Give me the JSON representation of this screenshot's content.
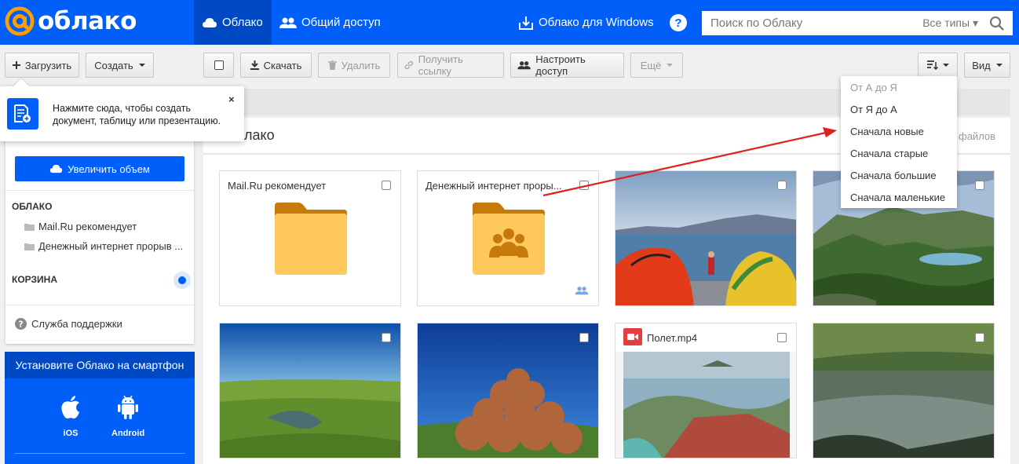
{
  "header": {
    "logo_text": "облако",
    "tabs": [
      {
        "label": "Облако"
      },
      {
        "label": "Общий доступ"
      }
    ],
    "windows_link": "Облако для Windows",
    "help": "?",
    "search": {
      "placeholder": "Поиск по Облаку",
      "types_label": "Все типы"
    }
  },
  "toolbar": {
    "upload": "Загрузить",
    "create": "Создать",
    "download": "Скачать",
    "delete": "Удалить",
    "get_link": "Получить ссылку",
    "share_settings": "Настроить доступ",
    "more": "Ещё",
    "view": "Вид"
  },
  "tooltip": {
    "text": "Нажмите сюда, чтобы создать документ, таблицу или презентацию.",
    "close": "×"
  },
  "sidebar": {
    "grow_button": "Увеличить объем",
    "cloud_heading": "ОБЛАКО",
    "items": [
      {
        "label": "Mail.Ru рекомендует"
      },
      {
        "label": "Денежный интернет прорыв ..."
      }
    ],
    "trash_heading": "КОРЗИНА",
    "support": "Служба поддержки"
  },
  "promo": {
    "title": "Установите Облако на смартфон",
    "ios": "iOS",
    "android": "Android"
  },
  "main": {
    "title": "лако",
    "files_count": "файлов"
  },
  "tiles": [
    {
      "label": "Mail.Ru рекомендует",
      "type": "folder"
    },
    {
      "label": "Денежный интернет проры...",
      "type": "shared-folder"
    },
    {
      "label": "",
      "type": "photo-tents"
    },
    {
      "label": "",
      "type": "photo-lake-mountains"
    },
    {
      "label": "",
      "type": "photo-field"
    },
    {
      "label": "",
      "type": "photo-hay"
    },
    {
      "label": "Полет.mp4",
      "type": "video"
    },
    {
      "label": "",
      "type": "photo-forest-lake"
    }
  ],
  "sort_menu": {
    "options": [
      {
        "label": "От А до Я",
        "state": "selected"
      },
      {
        "label": "От Я до А"
      },
      {
        "label": "Сначала новые"
      },
      {
        "label": "Сначала старые"
      },
      {
        "label": "Сначала большие"
      },
      {
        "label": "Сначала маленькие"
      }
    ]
  },
  "colors": {
    "brand": "#005ff9",
    "brand_dark": "#0049c4",
    "folder": "#ffc95e",
    "folder_dark": "#c77a0c",
    "annotation_arrow": "#e0201c"
  }
}
